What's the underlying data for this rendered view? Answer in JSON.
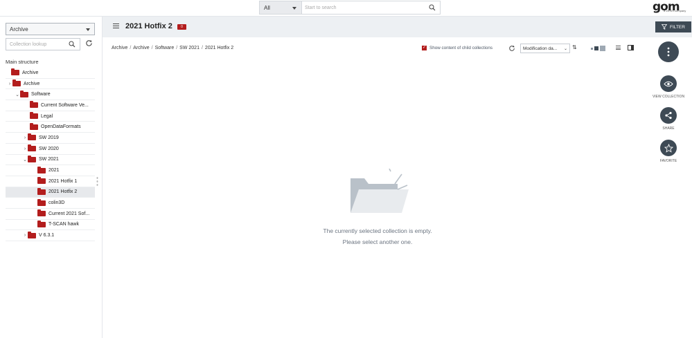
{
  "topbar": {
    "scope_label": "All",
    "search_placeholder": "Start to search",
    "logo_text": "gom",
    "logo_subtitle": "a ZEISS company"
  },
  "sidebar": {
    "archive_select": "Archive",
    "lookup_placeholder": "Collection lookup",
    "section_title": "Main structure",
    "items": [
      {
        "label": "Archive",
        "chevron": ""
      },
      {
        "label": "Archive",
        "chevron": "›"
      },
      {
        "label": "Software",
        "chevron": "⌄"
      },
      {
        "label": "Current Software Ve...",
        "chevron": ""
      },
      {
        "label": "Legal",
        "chevron": ""
      },
      {
        "label": "OpenDataFormats",
        "chevron": ""
      },
      {
        "label": "SW 2019",
        "chevron": "›"
      },
      {
        "label": "SW 2020",
        "chevron": "›"
      },
      {
        "label": "SW 2021",
        "chevron": "⌄"
      },
      {
        "label": "2021",
        "chevron": ""
      },
      {
        "label": "2021 Hotfix 1",
        "chevron": ""
      },
      {
        "label": "2021 Hotfix 2",
        "chevron": ""
      },
      {
        "label": "colin3D",
        "chevron": ""
      },
      {
        "label": "Current 2021 Sof...",
        "chevron": ""
      },
      {
        "label": "T-SCAN hawk",
        "chevron": ""
      },
      {
        "label": "V 6.3.1",
        "chevron": "›"
      }
    ]
  },
  "header": {
    "title": "2021 Hotfix 2",
    "count": "0",
    "filter_label": "FILTER"
  },
  "breadcrumb": [
    "Archive",
    "Archive",
    "Software",
    "SW 2021",
    "2021 Hotfix 2"
  ],
  "toolbar": {
    "child_collections_label": "Show content of child collections",
    "sort_value": "Modification da..."
  },
  "empty_state": {
    "line1": "The currently selected collection is empty.",
    "line2": "Please select another one."
  },
  "actions": {
    "view_collection": "VIEW COLLECTION",
    "share": "SHARE",
    "favorite": "FAVORITE"
  },
  "colors": {
    "accent": "#b31d1d",
    "dark": "#3e4a55",
    "header_bg": "#edf0f3"
  }
}
